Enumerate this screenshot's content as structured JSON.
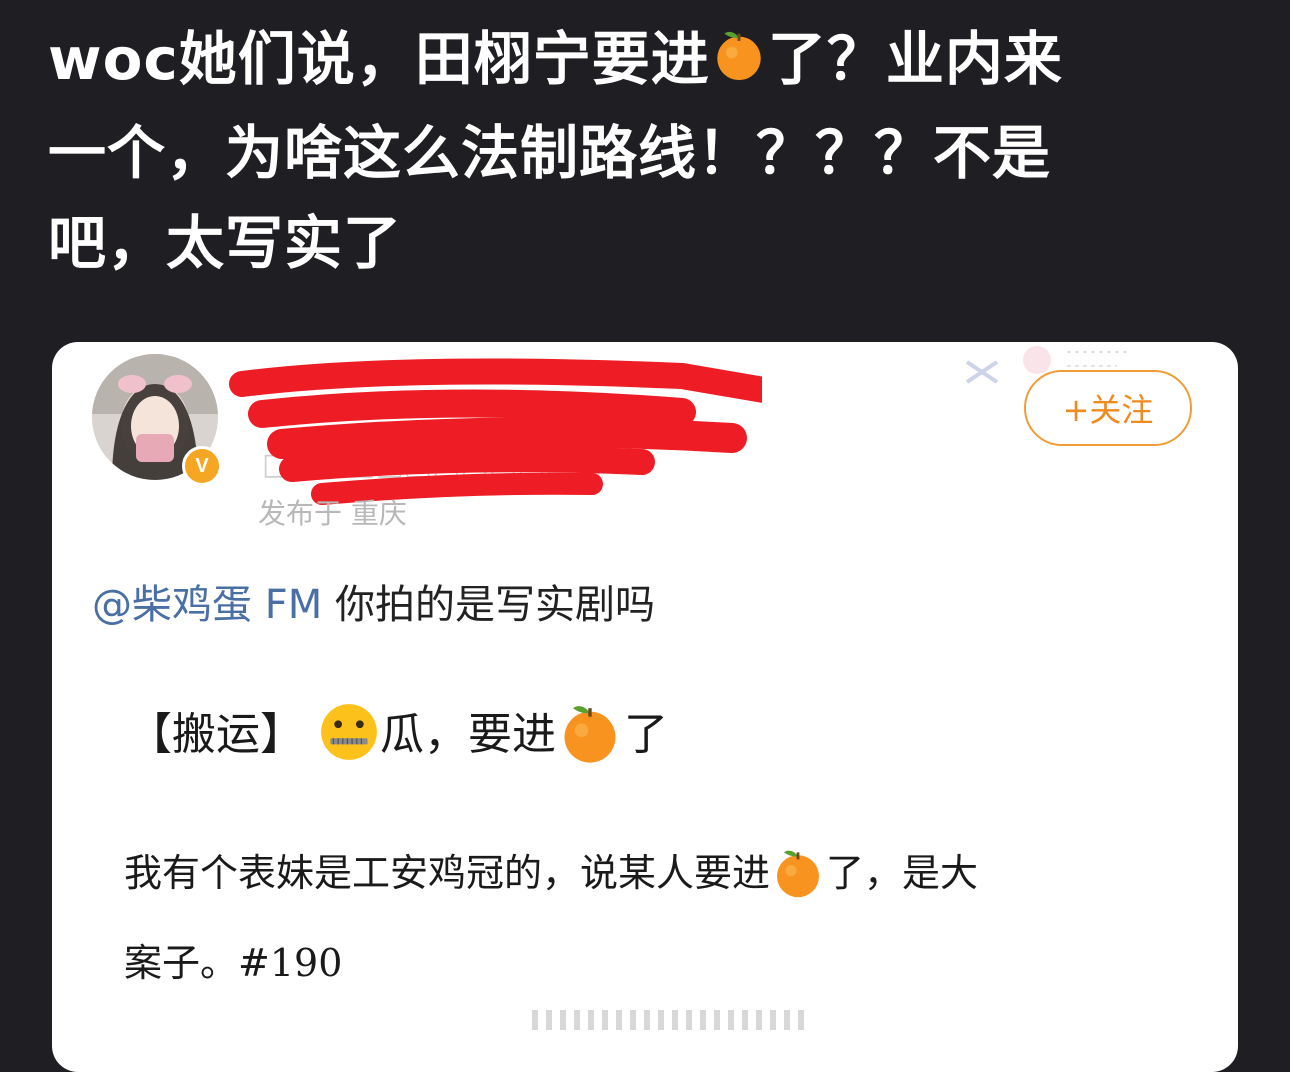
{
  "post": {
    "line1_a": "woc她们说，田栩宁要进",
    "line1_b": "了？业内来",
    "line2": "一个，为啥这么法制路线！？？？不是",
    "line3": "吧，太写实了"
  },
  "card": {
    "follow_label": "+关注",
    "location": "发布于 重庆",
    "mention": "@柴鸡蛋 FM",
    "reply_text": " 你拍的是写实剧吗",
    "headline_a": "【搬运】",
    "headline_b": "瓜，要进",
    "headline_c": "了",
    "para1_a": "我有个表妹是工安鸡冠的，说某人要进",
    "para1_b": "了，是大",
    "para2": "案子。#190"
  },
  "icons": {
    "tangerine": "tangerine-emoji-icon",
    "zipper_mouth": "zipper-mouth-face-icon",
    "verified": "verified-v-badge-icon"
  },
  "colors": {
    "background": "#1f1f23",
    "accent_orange": "#ef8a20",
    "mention_blue": "#4a6fa5",
    "redaction_red": "#ee1c25"
  }
}
